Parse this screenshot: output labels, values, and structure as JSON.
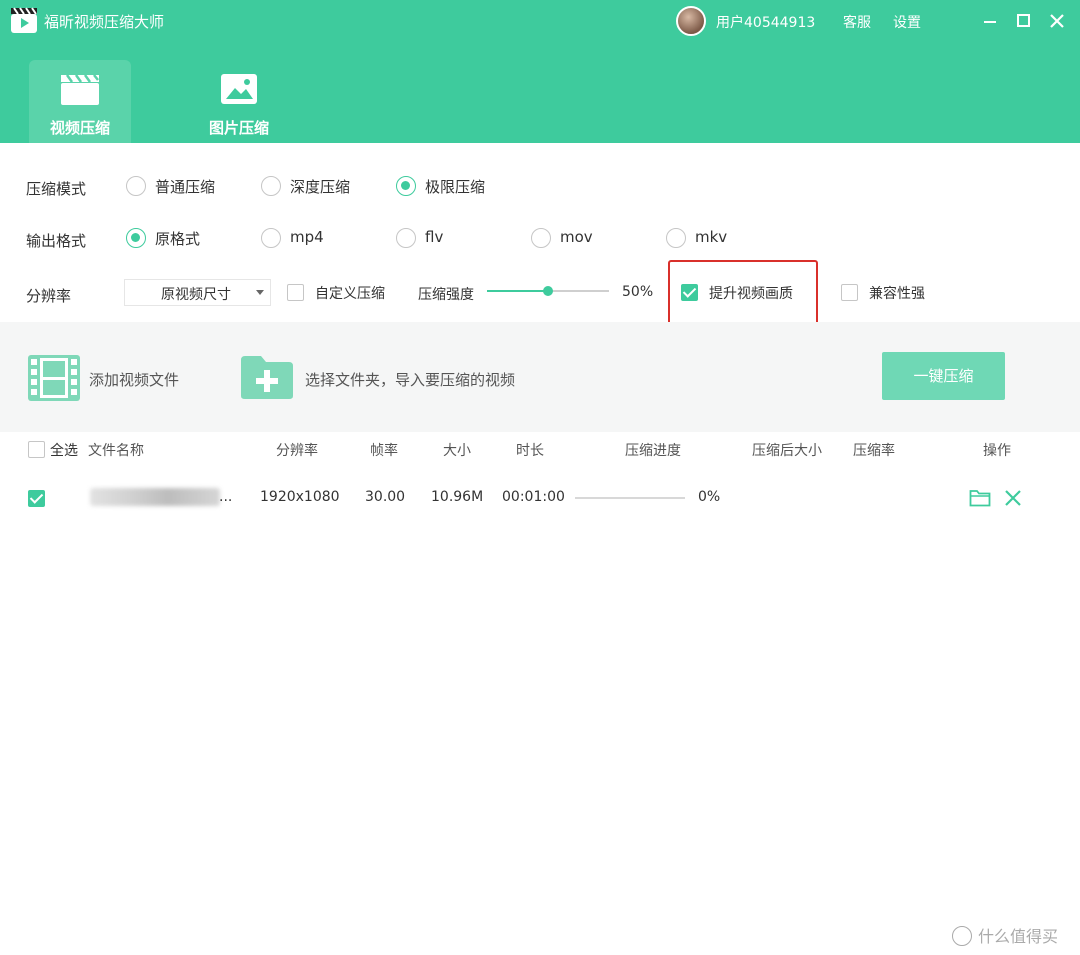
{
  "app": {
    "title": "福昕视频压缩大师"
  },
  "header": {
    "user_name": "用户40544913",
    "service_label": "客服",
    "settings_label": "设置"
  },
  "nav": {
    "tabs": [
      {
        "label": "视频压缩",
        "active": true,
        "icon": "film-clapper-icon"
      },
      {
        "label": "图片压缩",
        "active": false,
        "icon": "image-icon"
      }
    ]
  },
  "settings": {
    "mode": {
      "label": "压缩模式",
      "options": [
        "普通压缩",
        "深度压缩",
        "极限压缩"
      ],
      "selected": "极限压缩"
    },
    "format": {
      "label": "输出格式",
      "options": [
        "原格式",
        "mp4",
        "flv",
        "mov",
        "mkv"
      ],
      "selected": "原格式"
    },
    "resolution": {
      "label": "分辨率",
      "select_value": "原视频尺寸",
      "custom_label": "自定义压缩",
      "strength_label": "压缩强度",
      "strength_value": "50%",
      "strength_fraction": 0.5,
      "enhance_label": "提升视频画质",
      "enhance_checked": true,
      "compat_label": "兼容性强",
      "compat_checked": false
    }
  },
  "actions": {
    "add_file_label": "添加视频文件",
    "add_folder_label": "选择文件夹，导入要压缩的视频",
    "compress_label": "一键压缩"
  },
  "table": {
    "select_all_label": "全选",
    "headers": {
      "name": "文件名称",
      "resolution": "分辨率",
      "fps": "帧率",
      "size": "大小",
      "duration": "时长",
      "progress": "压缩进度",
      "after_size": "压缩后大小",
      "ratio": "压缩率",
      "ops": "操作"
    },
    "rows": [
      {
        "checked": true,
        "name_tail": "...",
        "resolution": "1920x1080",
        "fps": "30.00",
        "size": "10.96M",
        "duration": "00:01:00",
        "progress_text": "0%",
        "progress_fraction": 0
      }
    ]
  },
  "watermark": {
    "text": "什么值得买"
  },
  "colors": {
    "accent": "#3ecb9d",
    "highlight": "#d9302b"
  }
}
